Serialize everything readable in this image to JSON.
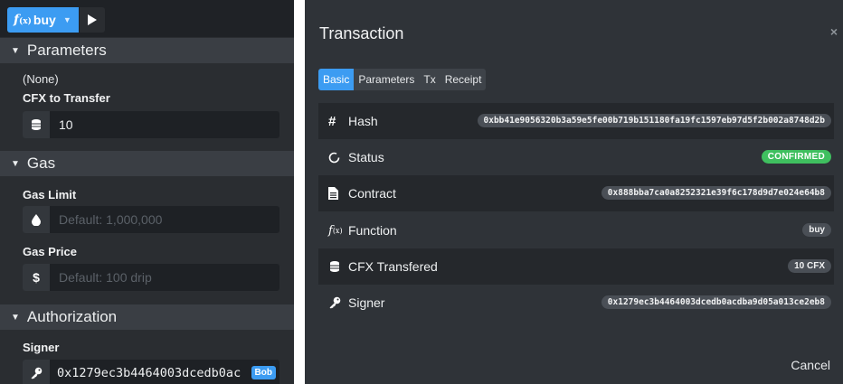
{
  "left_panel": {
    "function_button": {
      "fx": "f",
      "fx_sub": "(x)",
      "name": "buy"
    },
    "sections": {
      "parameters": "Parameters",
      "gas": "Gas",
      "authorization": "Authorization"
    },
    "parameters_none": "(None)",
    "cfx_label": "CFX to Transfer",
    "cfx_value": "10",
    "gas_limit_label": "Gas Limit",
    "gas_limit_placeholder": "Default: 1,000,000",
    "gas_price_label": "Gas Price",
    "gas_price_placeholder": "Default: 100 drip",
    "signer_label": "Signer",
    "signer_value": "0x1279ec3b4464003dcedb0ac",
    "signer_tag": "Bob",
    "icons": [
      "coins-icon",
      "drop-icon",
      "dollar-icon",
      "key-icon",
      "play-icon",
      "caret-down-icon"
    ]
  },
  "dialog": {
    "title": "Transaction",
    "close": "×",
    "tabs": [
      "Basic",
      "Parameters",
      "Tx",
      "Receipt"
    ],
    "active_tab": "Basic",
    "rows": [
      {
        "label": "Hash",
        "icon": "hash-icon",
        "value": "0xbb41e9056320b3a59e5fe00b719b151180fa19fc1597eb97d5f2b002a8748d2b"
      },
      {
        "label": "Status",
        "icon": "circle-notch-icon",
        "value": "CONFIRMED"
      },
      {
        "label": "Contract",
        "icon": "file-icon",
        "value": "0x888bba7ca0a8252321e39f6c178d9d7e024e64b8"
      },
      {
        "label": "Function",
        "icon": "function-icon",
        "value": "buy"
      },
      {
        "label": "CFX Transfered",
        "icon": "coins-icon",
        "value": "10 CFX"
      },
      {
        "label": "Signer",
        "icon": "key-icon",
        "value": "0x1279ec3b4464003dcedb0acdba9d05a013ce2eb8"
      }
    ],
    "cancel": "Cancel",
    "colors": {
      "accent": "#3c9cf2",
      "confirmed": "#3fbf5f"
    }
  }
}
